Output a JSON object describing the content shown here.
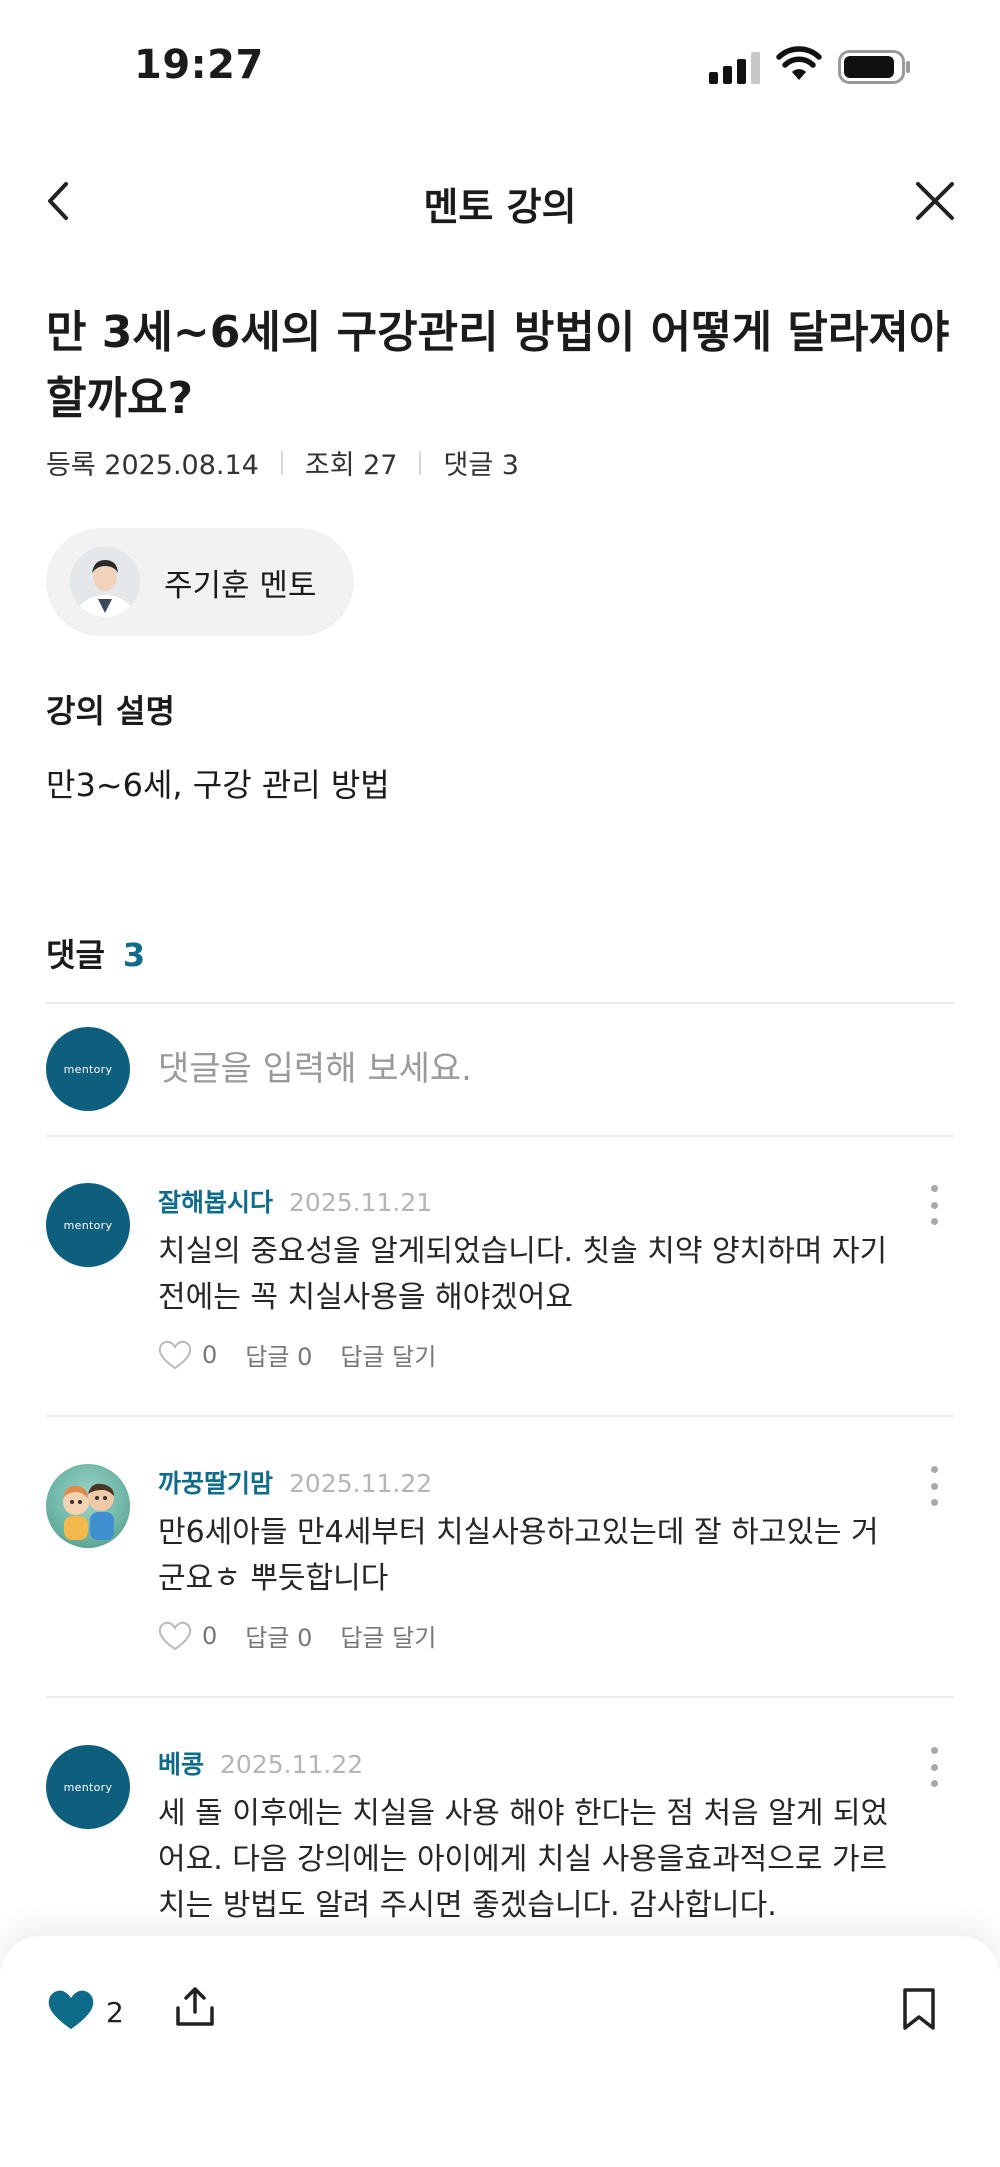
{
  "status_bar": {
    "time": "19:27"
  },
  "nav": {
    "title": "멘토 강의"
  },
  "lecture": {
    "title": "만 3세~6세의 구강관리 방법이 어떻게 달라져야 할까요?",
    "registered": "등록 2025.08.14",
    "views": "조회 27",
    "comment_count_label": "댓글 3"
  },
  "mentor": {
    "name": "주기훈 멘토"
  },
  "description": {
    "heading": "강의 설명",
    "body": "만3~6세, 구강 관리 방법"
  },
  "comments": {
    "header_label": "댓글",
    "count": "3",
    "input_placeholder": "댓글을 입력해 보세요.",
    "brand_avatar_text": "mentory",
    "items": [
      {
        "author": "잘해봅시다",
        "date": "2025.11.21",
        "text": "치실의 중요성을 알게되었습니다. 칫솔 치약 양치하며 자기 전에는 꼭 치실사용을 해야겠어요",
        "likes": "0",
        "replies": "답글 0",
        "reply_action": "답글 달기",
        "avatar": "brand-logo"
      },
      {
        "author": "까꿍딸기맘",
        "date": "2025.11.22",
        "text": "만6세아들 만4세부터 치실사용하고있는데 잘 하고있는 거군요ㅎ 뿌듯합니다",
        "likes": "0",
        "replies": "답글 0",
        "reply_action": "답글 달기",
        "avatar": "kids-illustration"
      },
      {
        "author": "베콩",
        "date": "2025.11.22",
        "text": "세 돌 이후에는 치실을 사용 해야 한다는 점 처음 알게 되었어요. 다음 강의에는 아이에게 치실 사용을효과적으로 가르치는 방법도 알려 주시면 좋겠습니다. 감사합니다.",
        "avatar": "brand-logo"
      }
    ]
  },
  "bottom_bar": {
    "like_count": "2"
  },
  "colors": {
    "accent": "#0f6b8a",
    "brand_avatar": "#0e5f7e",
    "chip_bg": "#f2f2f2"
  }
}
